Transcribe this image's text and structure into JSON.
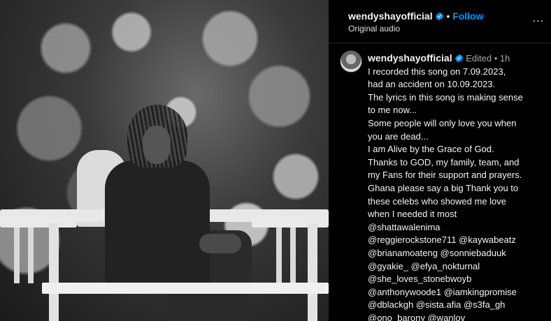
{
  "header": {
    "username": "wendyshayofficial",
    "separator": "•",
    "follow_label": "Follow",
    "subtitle": "Original audio",
    "more_label": "..."
  },
  "caption": {
    "username": "wendyshayofficial",
    "edited_label": "Edited",
    "separator": "•",
    "timestamp": "1h",
    "lines": [
      "I recorded this song on 7.09.2023,",
      "had an accident on 10.09.2023.",
      "The lyrics in this song is making sense",
      "to me now...",
      "Some people will only love you when",
      "you are dead...",
      "I am Alive by the Grace of God.",
      "Thanks to GOD, my family, team, and",
      "my Fans for their support and prayers.",
      "Ghana please say a big Thank you to",
      "these celebs who showed me love",
      "when I needed it most",
      "@shattawalenima",
      "@reggierockstone711 @kaywabeatz",
      "@brianamoateng @sonniebaduuk",
      "@gyakie_ @efya_nokturnal",
      "@she_loves_stonebwoyb",
      "@anthonywoode1 @iamkingpromise",
      "@dblackgh @sista.afia @s3fa_gh",
      "@ono_barony @wanlov"
    ]
  },
  "colors": {
    "background": "#000000",
    "follow": "#0095f6",
    "verified": "#0095f6",
    "meta": "#a8a8a8"
  },
  "icons": {
    "verified": "verified-badge-icon",
    "more": "more-options-icon"
  }
}
